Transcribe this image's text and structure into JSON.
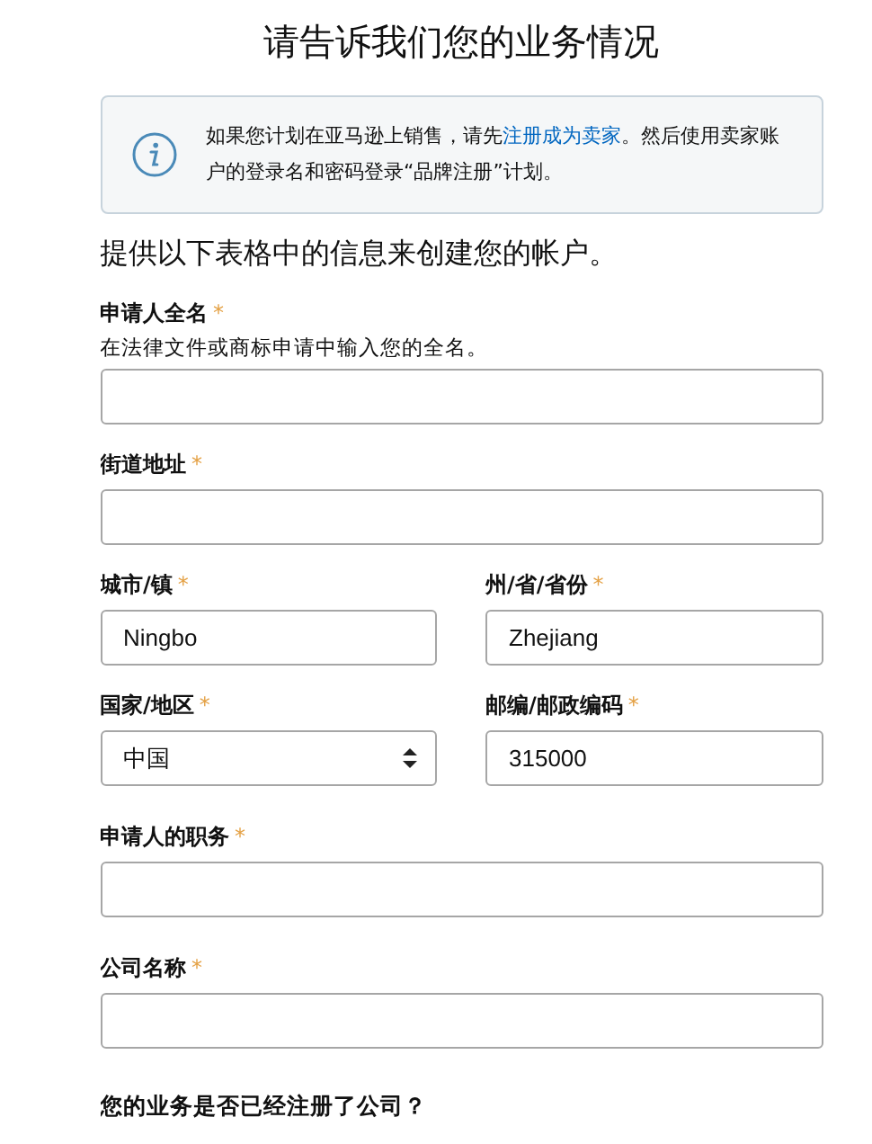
{
  "title": "请告诉我们您的业务情况",
  "notice": {
    "before": "如果您计划在亚马逊上销售，请先",
    "link": "注册成为卖家",
    "after": "。然后使用卖家账户的登录名和密码登录“品牌注册”计划。"
  },
  "intro": "提供以下表格中的信息来创建您的帐户。",
  "rows": [
    {
      "fields": [
        {
          "kind": "text",
          "label": "申请人全名",
          "mark": "*",
          "hint": "在法律文件或商标申请中输入您的全名。"
        }
      ]
    },
    {
      "fields": [
        {
          "kind": "text",
          "label": "街道地址",
          "mark": "*"
        }
      ]
    },
    {
      "fields": [
        {
          "kind": "text",
          "label": "城市/镇",
          "mark": "*",
          "value": "Ningbo"
        },
        {
          "kind": "text",
          "label": "州/省/省份",
          "mark": "*",
          "value": "Zhejiang"
        }
      ]
    },
    {
      "fields": [
        {
          "kind": "select",
          "label": "国家/地区",
          "mark": "*",
          "value": "中国"
        },
        {
          "kind": "text",
          "label": "邮编/邮政编码",
          "mark": "*",
          "value": "315000"
        }
      ]
    },
    {
      "fields": [
        {
          "kind": "text",
          "label": "申请人的职务",
          "mark": "*"
        }
      ],
      "spaced": true
    },
    {
      "fields": [
        {
          "kind": "text",
          "label": "公司名称",
          "mark": "*"
        }
      ],
      "spaced": true
    }
  ],
  "question": "您的业务是否已经注册了公司？"
}
